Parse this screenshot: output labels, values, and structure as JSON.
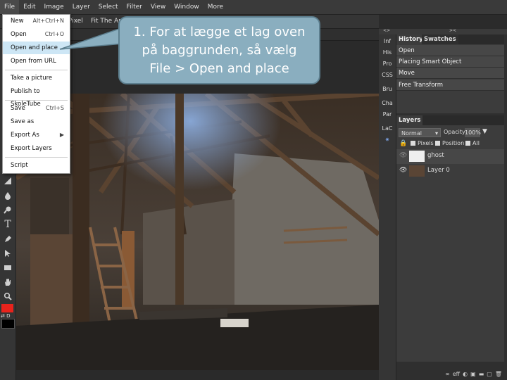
{
  "menubar": {
    "items": [
      "File",
      "Edit",
      "Image",
      "Layer",
      "Select",
      "Filter",
      "View",
      "Window",
      "More"
    ]
  },
  "options_bar": {
    "pixel_label": "Pixel",
    "fit_area_label": "Fit The Area"
  },
  "file_menu": {
    "items": [
      {
        "label": "New",
        "shortcut": "Alt+Ctrl+N"
      },
      {
        "label": "Open",
        "shortcut": "Ctrl+O"
      },
      {
        "label": "Open and place",
        "shortcut": ""
      },
      {
        "label": "Open from URL",
        "shortcut": ""
      },
      {
        "label": "Take a picture",
        "shortcut": ""
      },
      {
        "label": "Publish to SkoleTube",
        "shortcut": ""
      },
      {
        "label": "Save",
        "shortcut": "Ctrl+S"
      },
      {
        "label": "Save as",
        "shortcut": ""
      },
      {
        "label": "Export As",
        "shortcut": "▶"
      },
      {
        "label": "Export Layers",
        "shortcut": ""
      },
      {
        "label": "Script",
        "shortcut": ""
      }
    ]
  },
  "callout": {
    "line1": "1. For at lægge et lag oven",
    "line2": "på baggrunden, så vælg",
    "line3": "File > Open and place"
  },
  "mini_panel": {
    "items": [
      "Inf",
      "His",
      "Pro",
      "CSS",
      "Bru",
      "Cha",
      "Par",
      "LaC"
    ]
  },
  "collapse_bar": {
    "left": "<>",
    "right": "><"
  },
  "history": {
    "tab_history": "History",
    "tab_swatches": "Swatches",
    "entries": [
      "Open",
      "Placing Smart Object",
      "Move",
      "Free Transform"
    ]
  },
  "layers": {
    "title": "Layers",
    "blend_mode": "Normal",
    "opacity_label": "Opacity:",
    "opacity_value": "100%",
    "lock_pixels": "Pixels",
    "lock_position": "Position",
    "lock_all": "All",
    "items": [
      {
        "name": "ghost"
      },
      {
        "name": "Layer 0"
      }
    ]
  },
  "colors": {
    "foreground": "#e8231c",
    "background": "#000000",
    "highlight": "#cde6f5",
    "callout_fill": "#8aaebf"
  },
  "toolbar_icons": [
    "gradient-icon",
    "dropper-icon",
    "blur-icon",
    "text-icon",
    "pen-icon",
    "select-icon",
    "rect-icon",
    "hand-icon",
    "zoom-icon"
  ],
  "footer_icons": [
    "link-icon",
    "eff-icon",
    "half-circle-icon",
    "mask-icon",
    "folder-icon",
    "new-layer-icon",
    "trash-icon"
  ]
}
